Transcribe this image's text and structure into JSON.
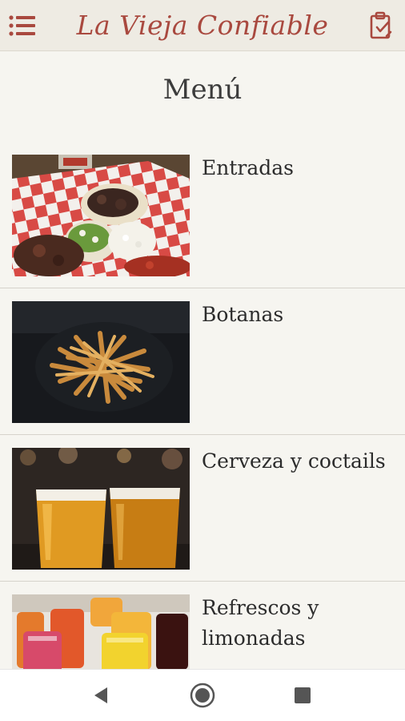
{
  "header": {
    "title": "La Vieja Confiable",
    "menu_icon": "hamburger-menu-icon",
    "order_icon": "clipboard-check-icon"
  },
  "page": {
    "title": "Menú"
  },
  "menu": {
    "items": [
      {
        "label": "Entradas",
        "image": "tacos-food-photo"
      },
      {
        "label": "Botanas",
        "image": "french-fries-photo"
      },
      {
        "label": "Cerveza y coctails",
        "image": "beer-glasses-photo"
      },
      {
        "label": "Refrescos y limonadas",
        "image": "soft-drinks-photo"
      }
    ]
  },
  "nav": {
    "back_icon": "back-triangle-icon",
    "home_icon": "home-circle-icon",
    "recent_icon": "recent-apps-square-icon"
  },
  "colors": {
    "accent": "#a9493f",
    "header_bg": "#eeebe3",
    "page_bg": "#f6f5f0",
    "text": "#2c2c2c"
  }
}
